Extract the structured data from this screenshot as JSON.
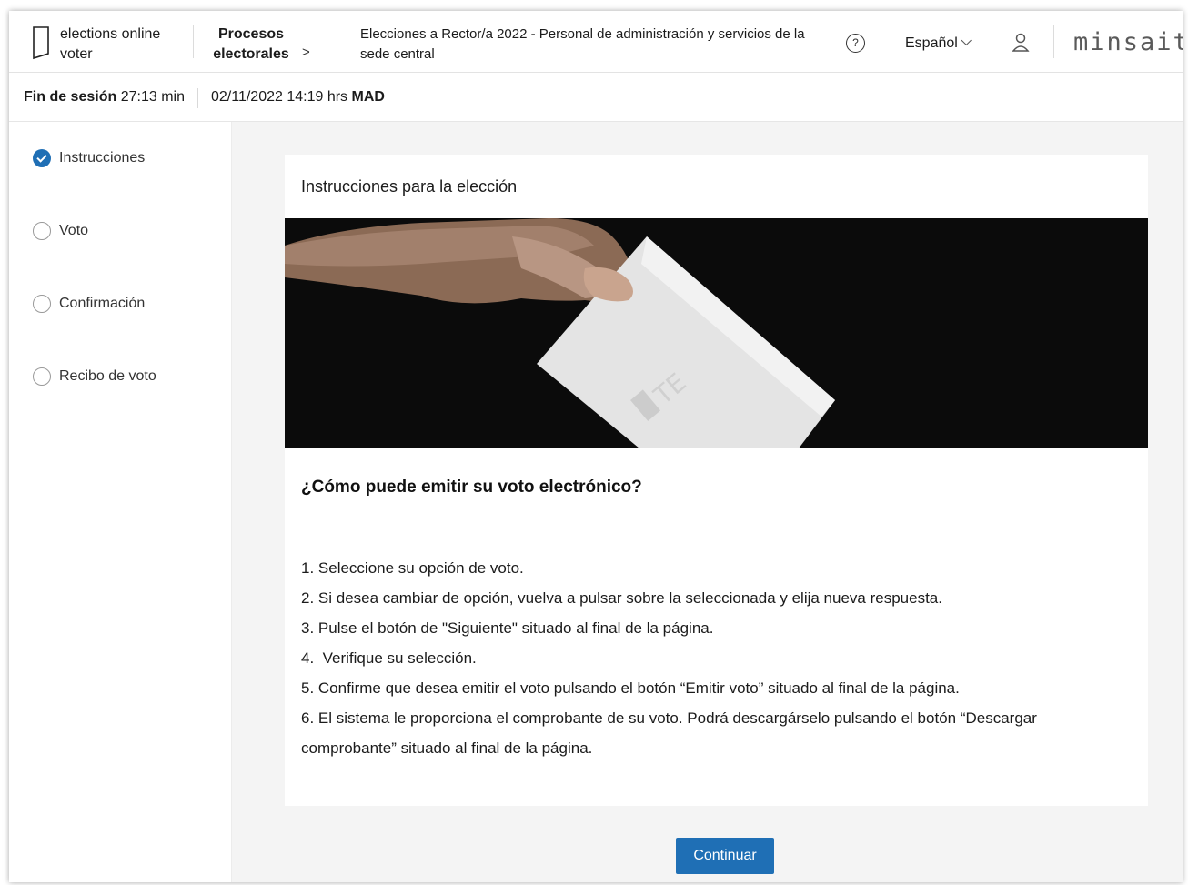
{
  "header": {
    "app_name": "elections online voter",
    "nav_procesos": "Procesos electorales",
    "breadcrumb_chevron": ">",
    "election_title": "Elecciones a Rector/a 2022 - Personal de administración y servicios de la sede central",
    "help_glyph": "?",
    "language": "Español",
    "brand": "minsait",
    "icons": [
      "logo-mark-icon",
      "help-icon",
      "chevron-down-icon",
      "user-icon"
    ]
  },
  "session": {
    "end_label": "Fin de sesión",
    "time_left": "27:13",
    "time_unit": "min",
    "datetime": "02/11/2022 14:19 hrs",
    "timezone": "MAD"
  },
  "sidebar": {
    "steps": [
      {
        "label": "Instrucciones",
        "checked": true
      },
      {
        "label": "Voto",
        "checked": false
      },
      {
        "label": "Confirmación",
        "checked": false
      },
      {
        "label": "Recibo de voto",
        "checked": false
      }
    ]
  },
  "main": {
    "card_title": "Instrucciones para la elección",
    "question": "¿Cómo puede emitir su voto electrónico?",
    "instructions": [
      "1. Seleccione su opción de voto.",
      "2. Si desea cambiar de opción, vuelva a pulsar sobre la seleccionada y elija nueva respuesta.",
      "3. Pulse el botón de \"Siguiente\" situado al final de la página.",
      "4.  Verifique su selección.",
      "5. Confirme que desea emitir el voto pulsando el botón “Emitir voto” situado al final de la página.",
      "6. El sistema le proporciona el comprobante de su voto. Podrá descargárselo pulsando el botón “Descargar comprobante” situado al final de la página."
    ],
    "continue_label": "Continuar"
  },
  "colors": {
    "accent": "#1f6fb5",
    "main_background": "#f4f4f4",
    "hero_background": "#0a0a0a"
  }
}
